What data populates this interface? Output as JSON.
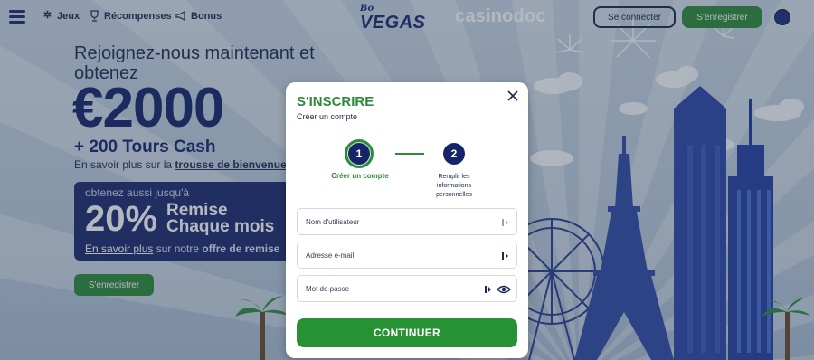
{
  "header": {
    "nav": [
      {
        "label": "Jeux",
        "icon": "star-burst-icon"
      },
      {
        "label": "Récompenses",
        "icon": "trophy-icon"
      },
      {
        "label": "Bonus",
        "icon": "megaphone-icon"
      }
    ],
    "logo_small": "Bo",
    "logo_big": "VEGAS",
    "partner_logo": "casinodoc",
    "login_label": "Se connecter",
    "register_label": "S'enregistrer"
  },
  "promo": {
    "line1": "Rejoignez-nous maintenant et obtenez",
    "amount": "€2000",
    "spins": "+ 200 Tours Cash",
    "kit_prefix": "En savoir plus sur la ",
    "kit_link": "trousse de bienvenue",
    "rebate_top": "obtenez aussi jusqu'à",
    "rebate_pct": "20%",
    "rebate_l1": "Remise",
    "rebate_l2": "Chaque mois",
    "rebate_more_link": "En savoir plus",
    "rebate_more_mid": " sur notre ",
    "rebate_more_bold": "offre de remise",
    "register_label": "S'enregistrer"
  },
  "modal": {
    "title": "S'INSCRIRE",
    "subtitle": "Créer un compte",
    "steps": [
      {
        "number": "1",
        "label": "Créer un compte"
      },
      {
        "number": "2",
        "label": "Remplir les informations personnelles"
      }
    ],
    "fields": {
      "username_placeholder": "Nom d'utilisateur",
      "email_placeholder": "Adresse e-mail",
      "password_placeholder": "Mot de passe"
    },
    "continue_label": "CONTINUER"
  },
  "colors": {
    "brand_navy": "#16256a",
    "brand_green": "#2e8b3a"
  }
}
